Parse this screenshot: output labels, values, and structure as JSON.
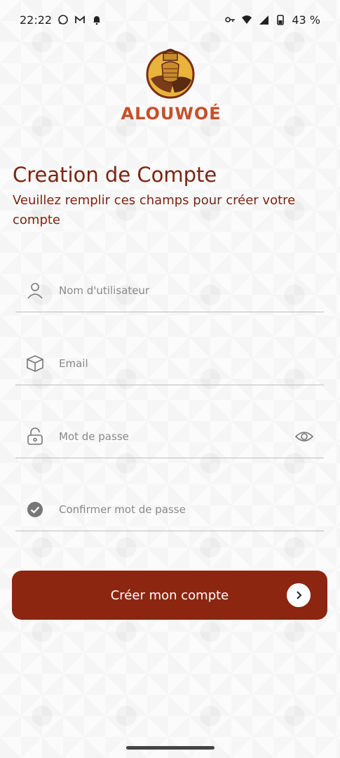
{
  "status_bar": {
    "time": "22:22",
    "battery": "43 %",
    "left_icons": [
      "whatsapp-icon",
      "gmail-icon",
      "bell-icon"
    ],
    "right_icons": [
      "key-icon",
      "wifi-icon",
      "signal-icon",
      "battery-icon"
    ]
  },
  "brand": {
    "name": "ALOUWOÉ",
    "colors": {
      "primary": "#8c2610",
      "title": "#7a2512",
      "logo_text": "#c4512a",
      "logo_gold": "#e8b43a"
    }
  },
  "header": {
    "title": "Creation de Compte",
    "subtitle": "Veuillez remplir ces champs pour créer votre compte"
  },
  "form": {
    "username": {
      "placeholder": "Nom d'utilisateur",
      "icon": "user-icon"
    },
    "email": {
      "placeholder": "Email",
      "icon": "cube-icon"
    },
    "password": {
      "placeholder": "Mot de passe",
      "icon": "lock-icon",
      "toggle_icon": "eye-icon"
    },
    "confirm_password": {
      "placeholder": "Confirmer mot de passe",
      "icon": "check-circle-icon"
    }
  },
  "submit": {
    "label": "Créer mon compte",
    "icon": "chevron-right-icon"
  }
}
